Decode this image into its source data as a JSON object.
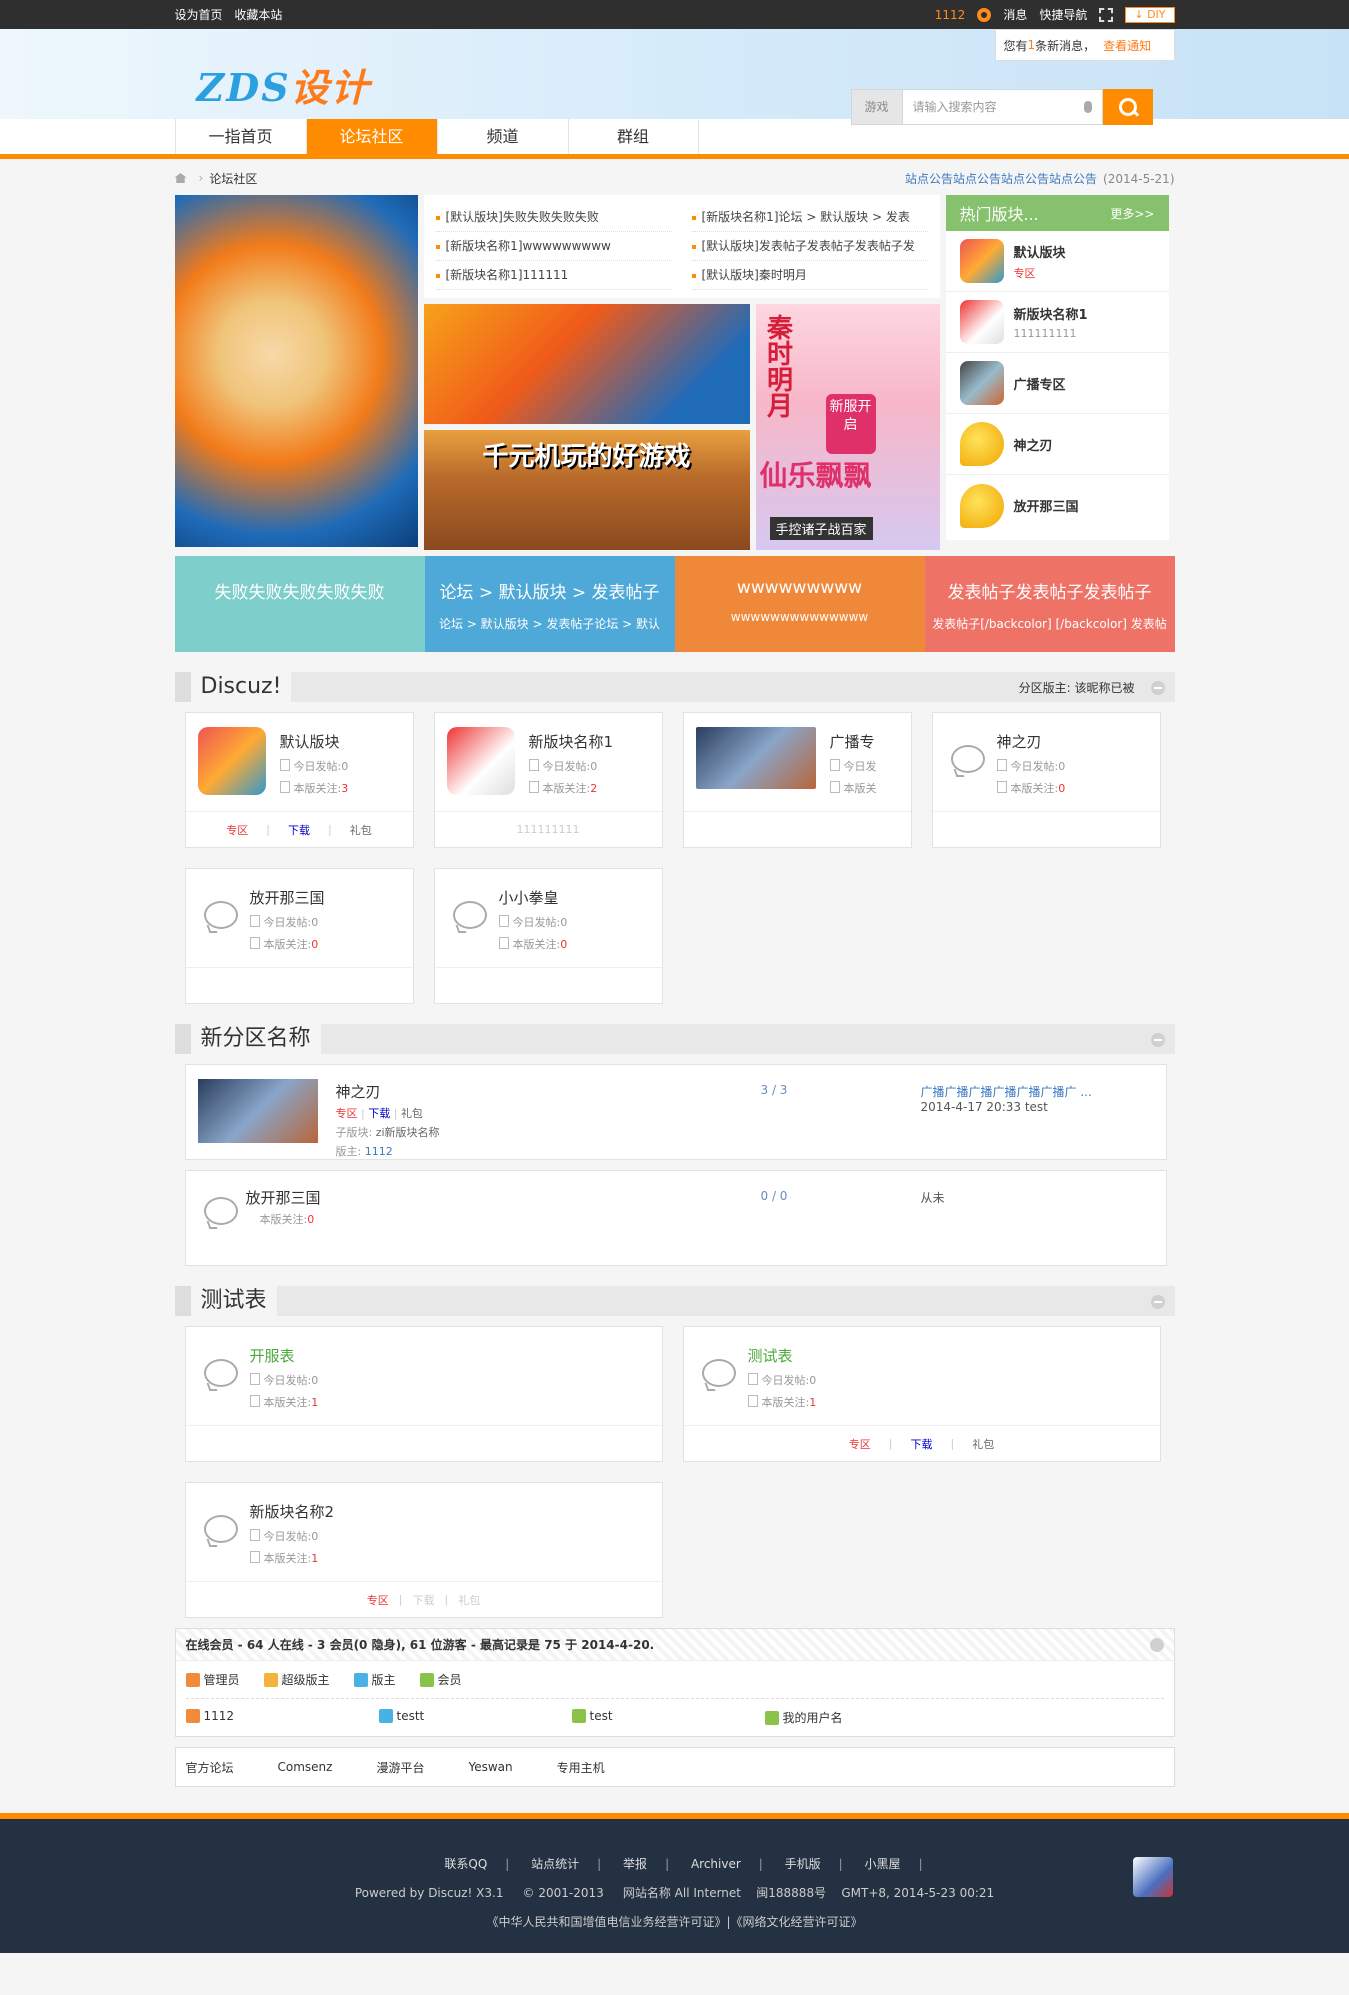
{
  "topbar": {
    "set_home": "设为首页",
    "bookmark": "收藏本站",
    "user": "1112",
    "messages": "消息",
    "quicknav": "快捷导航",
    "diy": "DIY"
  },
  "notice": {
    "prefix": "您有",
    "count": "1",
    "suffix": "条新消息，",
    "link": "查看通知"
  },
  "header": {
    "logo_a": "ZDS",
    "logo_b": "设计",
    "search_type": "游戏",
    "search_placeholder": "请输入搜索内容"
  },
  "nav": {
    "items": [
      "一指首页",
      "论坛社区",
      "频道",
      "群组"
    ],
    "active": "论坛社区"
  },
  "breadcrumb": {
    "current": "论坛社区",
    "announcement": "站点公告站点公告站点公告站点公告",
    "date": "(2014-5-21)"
  },
  "news": [
    "[默认版块]失败失败失败失败",
    "[新版块名称1]论坛 > 默认版块 > 发表",
    "[新版块名称1]wwwwwwwww",
    "[默认版块]发表帖子发表帖子发表帖子发",
    "[新版块名称1]111111",
    "[默认版块]秦时明月"
  ],
  "images": {
    "ad2_text": "千元机玩的好游戏",
    "ad3_title": "秦时明月",
    "ad3_badge": "新服开启",
    "ad3_main": "仙乐飘飘",
    "ad3_foot": "手控诸子战百家"
  },
  "hot": {
    "title": "热门版块...",
    "more": "更多>>",
    "items": [
      {
        "name": "默认版块",
        "sub": "专区"
      },
      {
        "name": "新版块名称1",
        "sub": "111111111"
      },
      {
        "name": "广播专区",
        "sub": ""
      },
      {
        "name": "神之刃",
        "sub": ""
      },
      {
        "name": "放开那三国",
        "sub": ""
      }
    ]
  },
  "tiles": [
    {
      "title": "失败失败失败失败失败",
      "sub": "",
      "color": "#7ecfcc"
    },
    {
      "title": "论坛 > 默认版块 > 发表帖子",
      "sub": "论坛 > 默认版块 > 发表帖子论坛 > 默认",
      "color": "#4ea8d8"
    },
    {
      "title": "wwwwwwwww",
      "sub": "wwwwwwwwwwwwww",
      "color": "#f0883a"
    },
    {
      "title": "发表帖子发表帖子发表帖子",
      "sub": "发表帖子[/backcolor] [/backcolor] 发表帖",
      "color": "#ee7266"
    }
  ],
  "labels": {
    "today": "今日发帖:",
    "follow": "本版关注:",
    "zone": "专区",
    "download": "下载",
    "gift": "礼包",
    "sub_forum": "子版块:",
    "moderator": "版主:"
  },
  "sections": {
    "discuz": {
      "title": "Discuz!",
      "moderator": "分区版主: 该昵称已被",
      "cards": [
        {
          "name": "默认版块",
          "today": "0",
          "follow": "3",
          "foot": "links"
        },
        {
          "name": "新版块名称1",
          "today": "0",
          "follow": "2",
          "foot": "111111111"
        },
        {
          "name": "广播专",
          "today": "今日发",
          "follow": "本版关",
          "foot": ""
        },
        {
          "name": "神之刃",
          "today": "0",
          "follow": "0",
          "foot": ""
        },
        {
          "name": "放开那三国",
          "today": "0",
          "follow": "0",
          "foot": ""
        },
        {
          "name": "小小拳皇",
          "today": "0",
          "follow": "0",
          "foot": ""
        }
      ]
    },
    "newzone": {
      "title": "新分区名称",
      "rows": [
        {
          "name": "神之刃",
          "links": "专区 | 下载 | 礼包",
          "sub": "zi新版块名称",
          "mod": "1112",
          "count": "3 / 3",
          "last_title": "广播广播广播广播广播广播广 ...",
          "last_info": "2014-4-17 20:33 test"
        },
        {
          "name": "放开那三国",
          "follow": "0",
          "count": "0 / 0",
          "last_title": "从未",
          "last_info": ""
        }
      ]
    },
    "test": {
      "title": "测试表",
      "cards": [
        {
          "name": "开服表",
          "today": "0",
          "follow": "1"
        },
        {
          "name": "测试表",
          "today": "0",
          "follow": "1"
        },
        {
          "name": "新版块名称2",
          "today": "0",
          "follow": "1"
        }
      ]
    }
  },
  "online": {
    "summary": "在线会员 - 64 人在线 - 3 会员(0 隐身), 61 位游客 - 最高记录是 75 于 2014-4-20.",
    "legend": [
      "管理员",
      "超级版主",
      "版主",
      "会员"
    ],
    "users": [
      "1112",
      "testt",
      "test",
      "我的用户名"
    ]
  },
  "links": [
    "官方论坛",
    "Comsenz",
    "漫游平台",
    "Yeswan",
    "专用主机"
  ],
  "footer": {
    "nav": [
      "联系QQ",
      "站点统计",
      "举报",
      "Archiver",
      "手机版",
      "小黑屋"
    ],
    "powered": "Powered by Discuz! X3.1",
    "copyright": "© 2001-2013",
    "site": "网站名称 All Internet",
    "icp": "闽188888号",
    "time": "GMT+8, 2014-5-23 00:21",
    "license": "《中华人民共和国增值电信业务经营许可证》|《网络文化经营许可证》"
  },
  "colors": {
    "accent": "#ff8c00",
    "hot_header": "#86c16d",
    "footer_bg": "#233142",
    "topbar_bg": "#2f2f2f"
  }
}
